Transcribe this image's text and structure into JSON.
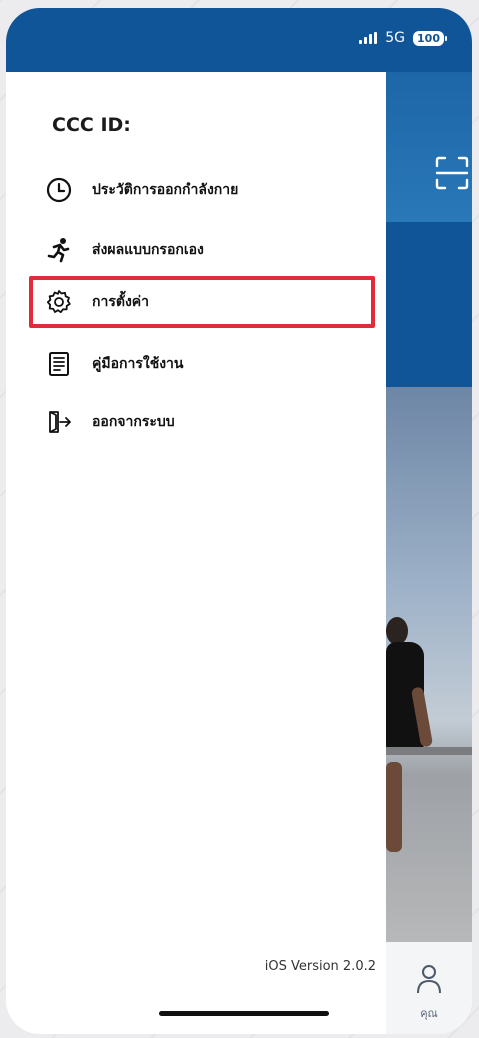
{
  "status_bar": {
    "network": "5G",
    "battery": "100"
  },
  "drawer": {
    "title": "CCC ID:",
    "menu": [
      {
        "label": "ประวัติการออกกำลังกาย",
        "icon": "clock-icon"
      },
      {
        "label": "ส่งผลแบบกรอกเอง",
        "icon": "running-icon"
      },
      {
        "label": "การตั้งค่า",
        "icon": "gear-icon"
      },
      {
        "label": "คู่มือการใช้งาน",
        "icon": "document-icon"
      },
      {
        "label": "ออกจากระบบ",
        "icon": "logout-icon"
      }
    ],
    "version": "iOS Version 2.0.2"
  },
  "tab_bar": {
    "profile_label": "คุณ"
  },
  "colors": {
    "brand_blue": "#0f5597",
    "highlight_red": "#e12a3a"
  }
}
